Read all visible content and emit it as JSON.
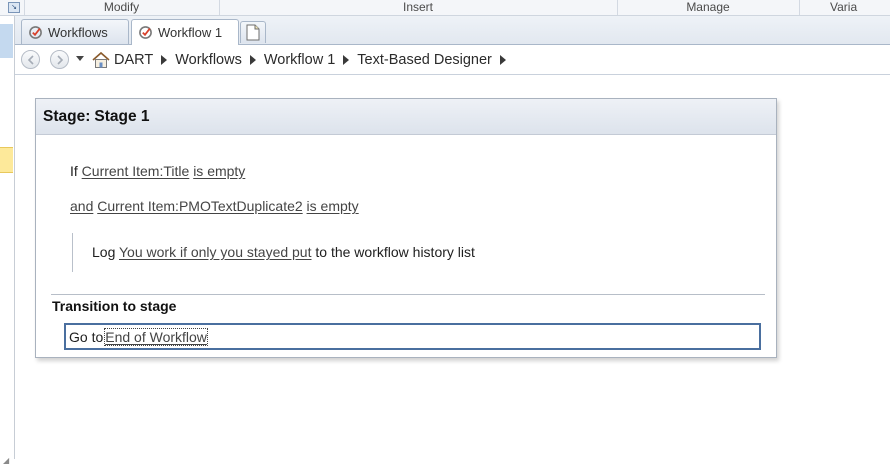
{
  "ribbon": {
    "groups": [
      "Modify",
      "Insert",
      "Manage",
      "Varia"
    ]
  },
  "tabs": [
    {
      "label": "Workflows"
    },
    {
      "label": "Workflow 1"
    }
  ],
  "breadcrumb": {
    "items": [
      "DART",
      "Workflows",
      "Workflow 1",
      "Text-Based Designer"
    ]
  },
  "stage": {
    "prefix": "Stage:",
    "name": "Stage 1",
    "condition1": {
      "keyword": "If",
      "field": "Current Item:Title",
      "operator": "is empty"
    },
    "condition2": {
      "keyword": "and",
      "field": "Current Item:PMOTextDuplicate2",
      "operator": "is empty"
    },
    "action": {
      "verb": "Log",
      "message": "You work if only you stayed put",
      "suffix": "to the workflow history list"
    },
    "transition_title": "Transition to stage",
    "transition": {
      "prefix": "Go to",
      "target": "End of Workflow"
    }
  },
  "colors": {
    "accent_border": "#4a6f9f",
    "selected_item": "#fde99a",
    "icon_red": "#d9412b"
  }
}
